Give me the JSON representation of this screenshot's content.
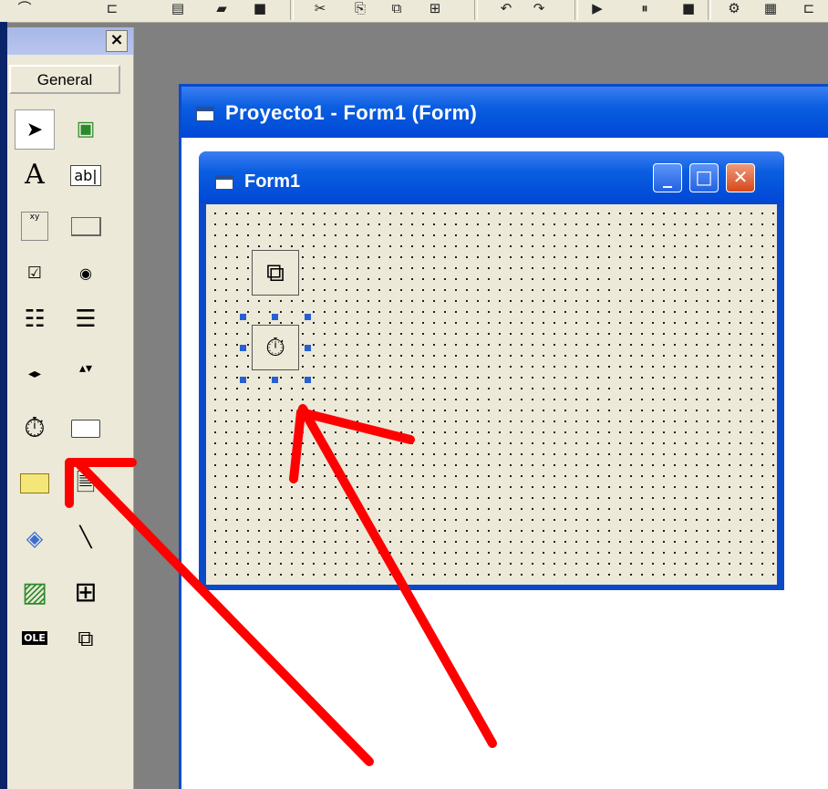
{
  "toolbox": {
    "close_label": "×",
    "tab_label": "General",
    "tools": [
      {
        "name": "pointer",
        "glyph": "➤"
      },
      {
        "name": "picturebox",
        "glyph": "▣"
      },
      {
        "name": "label",
        "glyph": "A"
      },
      {
        "name": "textbox",
        "glyph": "ab|"
      },
      {
        "name": "frame",
        "glyph": "xy"
      },
      {
        "name": "commandbutton",
        "glyph": "▭"
      },
      {
        "name": "checkbox",
        "glyph": "☑"
      },
      {
        "name": "optionbutton",
        "glyph": "◉"
      },
      {
        "name": "combobox",
        "glyph": "☷"
      },
      {
        "name": "listbox",
        "glyph": "☰"
      },
      {
        "name": "hscrollbar",
        "glyph": "◂▸"
      },
      {
        "name": "vscrollbar",
        "glyph": "▴▾"
      },
      {
        "name": "timer",
        "glyph": "⏱"
      },
      {
        "name": "drivelistbox",
        "glyph": "▭"
      },
      {
        "name": "dirlistbox",
        "glyph": "▬"
      },
      {
        "name": "filelistbox",
        "glyph": "🗎"
      },
      {
        "name": "shape",
        "glyph": "◈"
      },
      {
        "name": "line",
        "glyph": "╲"
      },
      {
        "name": "image",
        "glyph": "▨"
      },
      {
        "name": "data",
        "glyph": "⊞"
      },
      {
        "name": "ole",
        "glyph": "OLE"
      },
      {
        "name": "component",
        "glyph": "⧉"
      }
    ]
  },
  "project_window": {
    "title": "Proyecto1 - Form1 (Form)"
  },
  "form": {
    "title": "Form1",
    "min_label": "_",
    "max_label": "□",
    "close_label": "✕"
  },
  "controls": {
    "component_glyph": "⧉",
    "timer_glyph": "⏱"
  },
  "colors": {
    "title_blue": "#0a5ee0",
    "arrow_red": "#ff0000",
    "face": "#ece9d8"
  }
}
